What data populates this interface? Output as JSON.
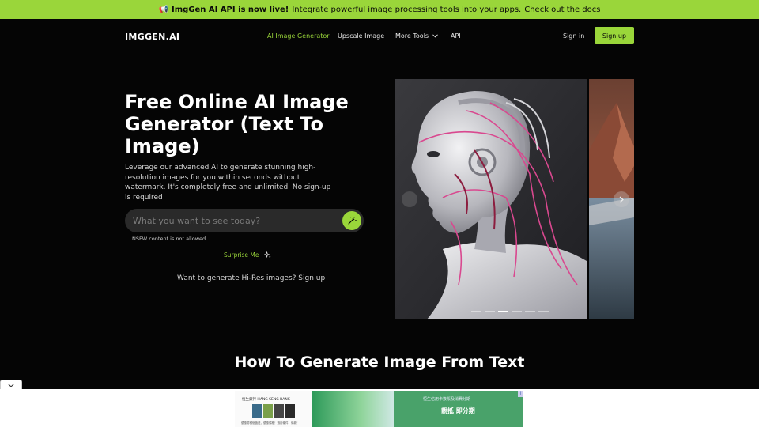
{
  "banner": {
    "icon": "📢",
    "headline": "ImgGen AI API is now live!",
    "text": "Integrate powerful image processing tools into your apps.",
    "link": "Check out the docs"
  },
  "nav": {
    "logo": "IMGGEN.AI",
    "links": [
      "AI Image Generator",
      "Upscale Image",
      "More Tools",
      "API"
    ],
    "active": "AI Image Generator",
    "signin": "Sign in",
    "signup": "Sign up"
  },
  "hero": {
    "title": "Free Online AI Image Generator (Text To Image)",
    "description": "Leverage our advanced AI to generate stunning high-resolution images for you within seconds without watermark. It's completely free and unlimited. No sign-up is required!",
    "prompt_placeholder": "What you want to see today?",
    "nsfw_note": "NSFW content is not allowed.",
    "surprise": "Surprise Me",
    "hires_text": "Want to generate Hi-Res images?",
    "hires_link": "Sign up"
  },
  "carousel": {
    "slides": 6,
    "active_index": 2
  },
  "section": {
    "title": "How To Generate Image From Text"
  },
  "ad": {
    "bank_name": "恒生銀行 HANG SENG BANK",
    "bank_line": "優惠幣種個值送，優惠價格！適用條件，條款！",
    "promo_line": "—恒生信用卡簽賬及消費分期—",
    "promo_title": "靚抵 即分期"
  },
  "colors": {
    "accent": "#9ad63a",
    "background": "#050505"
  }
}
